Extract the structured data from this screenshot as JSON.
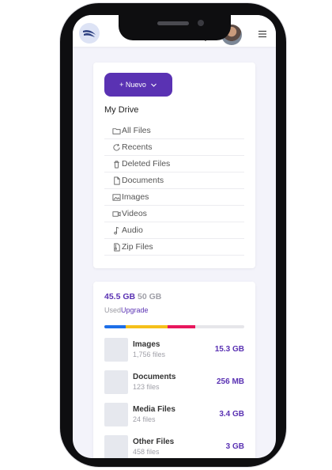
{
  "header": {
    "logo_icon": "feather-logo-icon",
    "bell_icon": "bell-icon",
    "menu_icon": "hamburger-menu-icon"
  },
  "sidebar": {
    "new_button_label": "+ Nuevo",
    "drive_title": "My Drive",
    "items": [
      {
        "label": "All Files",
        "icon": "folder-icon"
      },
      {
        "label": "Recents",
        "icon": "refresh-icon"
      },
      {
        "label": "Deleted Files",
        "icon": "trash-icon"
      },
      {
        "label": "Documents",
        "icon": "document-icon"
      },
      {
        "label": "Images",
        "icon": "image-icon"
      },
      {
        "label": "Videos",
        "icon": "video-icon"
      },
      {
        "label": "Audio",
        "icon": "music-note-icon"
      },
      {
        "label": "Zip Files",
        "icon": "zip-file-icon"
      }
    ]
  },
  "storage": {
    "used": "45.5 GB",
    "total": "50 GB",
    "used_label": "Used",
    "upgrade_label": "Upgrade",
    "bar_segments": [
      {
        "color": "#1e6fe8",
        "fraction": 0.15
      },
      {
        "color": "#f5c01b",
        "fraction": 0.3
      },
      {
        "color": "#e8175d",
        "fraction": 0.2
      }
    ],
    "files": [
      {
        "name": "Images",
        "count": "1,756 files",
        "size": "15.3 GB"
      },
      {
        "name": "Documents",
        "count": "123 files",
        "size": "256 MB"
      },
      {
        "name": "Media Files",
        "count": "24 files",
        "size": "3.4 GB"
      },
      {
        "name": "Other Files",
        "count": "458 files",
        "size": "3 GB"
      }
    ]
  },
  "colors": {
    "accent": "#5a32b3",
    "background": "#f3f3fa"
  }
}
